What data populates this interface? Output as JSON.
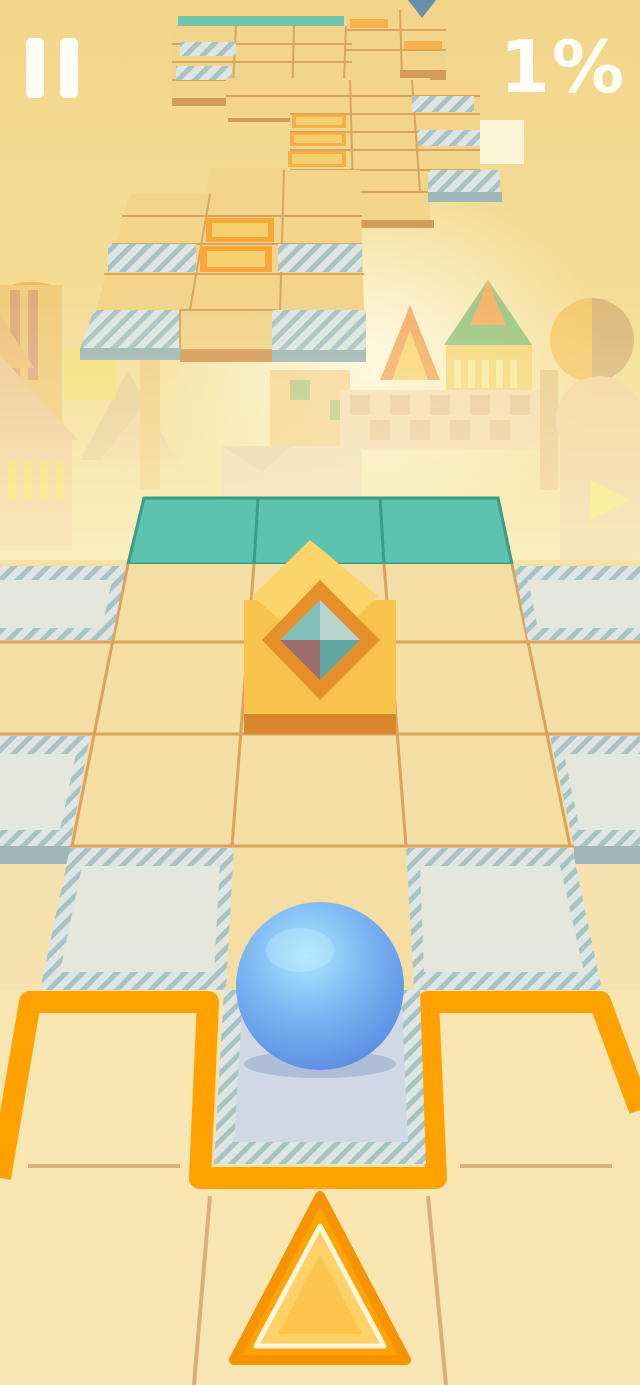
{
  "hud": {
    "progress_text": "1%",
    "progress_percent": 1,
    "pause_icon": "pause-icon"
  },
  "scene": {
    "player": "blue-ball",
    "ahead_control": "up-arrow-triangle-icon",
    "obstacle": "rotating-cube-icon"
  },
  "colors": {
    "sky_top": "#f3d98a",
    "sky_bottom": "#f8ecc2",
    "tile": "#f4dda0",
    "tile_line": "#d9a25e",
    "teal_tile": "#5cc2ad",
    "glass_tile": "#e4e6dc",
    "glass_stripe": "#a9c3c4",
    "orange_highlight": "#ffa400",
    "ball": "#7bb4f2",
    "cube": "#f8c044",
    "hud_text": "#fffdf6"
  }
}
